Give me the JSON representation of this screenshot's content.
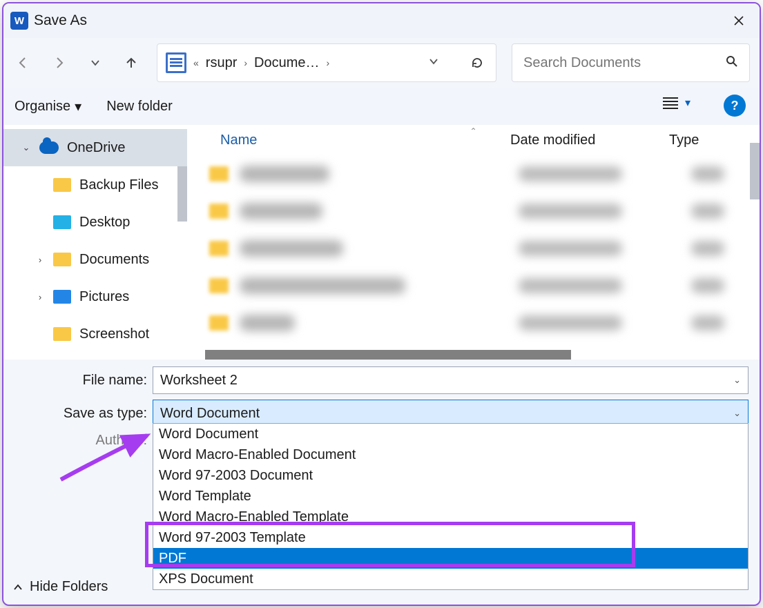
{
  "window": {
    "title": "Save As"
  },
  "nav": {
    "path_prefix": "«",
    "path_seg1": "rsupr",
    "path_seg2": "Docume…"
  },
  "search": {
    "placeholder": "Search Documents"
  },
  "toolbar": {
    "organise": "Organise",
    "newfolder": "New folder"
  },
  "tree": {
    "root": "OneDrive",
    "items": [
      {
        "label": "Backup Files"
      },
      {
        "label": "Desktop"
      },
      {
        "label": "Documents"
      },
      {
        "label": "Pictures"
      },
      {
        "label": "Screenshot"
      }
    ]
  },
  "columns": {
    "name": "Name",
    "date": "Date modified",
    "type": "Type"
  },
  "form": {
    "file_label": "File name:",
    "file_value": "Worksheet 2",
    "type_label": "Save as type:",
    "type_value": "Word Document",
    "authors_label": "Authors:"
  },
  "type_options": [
    "Word Document",
    "Word Macro-Enabled Document",
    "Word 97-2003 Document",
    "Word Template",
    "Word Macro-Enabled Template",
    "Word 97-2003 Template",
    "PDF",
    "XPS Document"
  ],
  "footer": {
    "hide": "Hide Folders"
  },
  "colors": {
    "accent": "#0078d4",
    "highlight": "#a63cf0"
  }
}
